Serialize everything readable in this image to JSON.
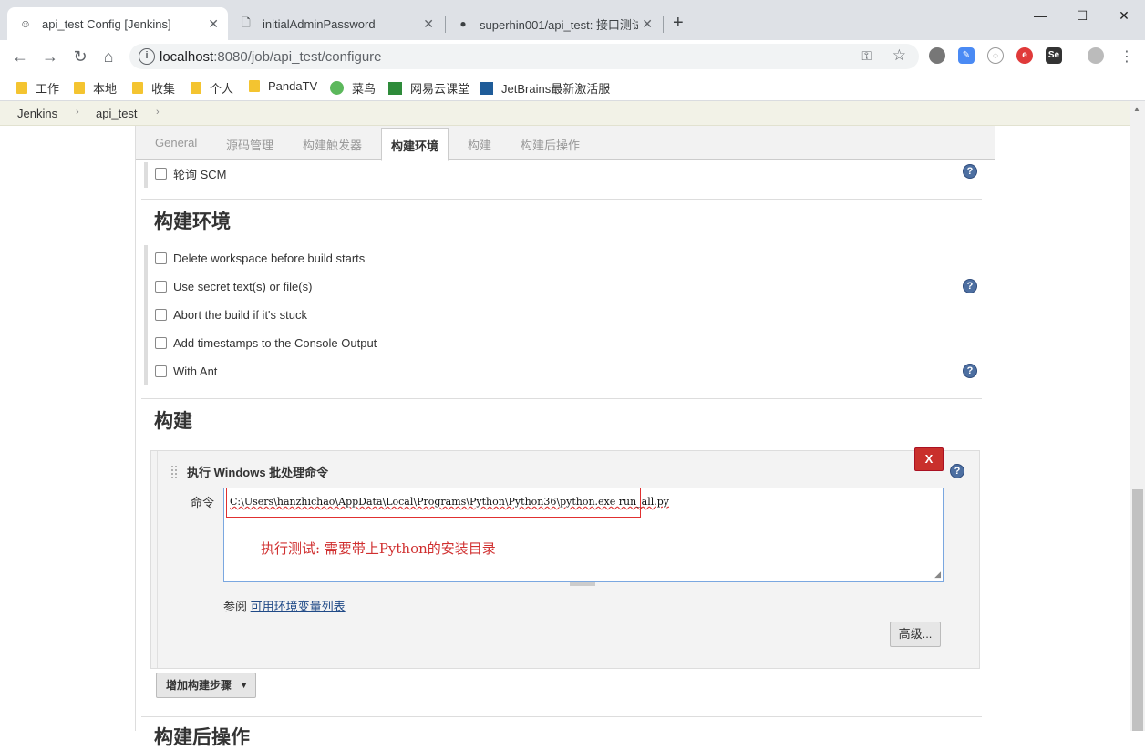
{
  "browser": {
    "tabs": [
      {
        "title": "api_test Config [Jenkins]",
        "icon": "jenkins-icon"
      },
      {
        "title": "initialAdminPassword",
        "icon": "document-icon"
      },
      {
        "title": "superhin001/api_test: 接口测试",
        "icon": "github-icon"
      }
    ],
    "url_host": "localhost",
    "url_rest": ":8080/job/api_test/configure",
    "bookmarks": [
      {
        "label": "工作",
        "icon": "folder-icon"
      },
      {
        "label": "本地",
        "icon": "folder-icon"
      },
      {
        "label": "收集",
        "icon": "folder-icon"
      },
      {
        "label": "个人",
        "icon": "folder-icon"
      },
      {
        "label": "PandaTV",
        "icon": "folder-icon"
      },
      {
        "label": "菜鸟",
        "icon": "runoob-icon"
      },
      {
        "label": "网易云课堂",
        "icon": "netease-icon"
      },
      {
        "label": "JetBrains最新激活服",
        "icon": "jetbrains-icon"
      }
    ]
  },
  "breadcrumbs": [
    "Jenkins",
    "api_test"
  ],
  "config_tabs": [
    "General",
    "源码管理",
    "构建触发器",
    "构建环境",
    "构建",
    "构建后操作"
  ],
  "poll_scm": "轮询 SCM",
  "build_env": {
    "title": "构建环境",
    "options": [
      "Delete workspace before build starts",
      "Use secret text(s) or file(s)",
      "Abort the build if it's stuck",
      "Add timestamps to the Console Output",
      "With Ant"
    ]
  },
  "build": {
    "title": "构建",
    "step_title": "执行 Windows 批处理命令",
    "delete_label": "X",
    "command_label": "命令",
    "command": "C:\\Users\\hanzhichao\\AppData\\Local\\Programs\\Python\\Python36\\python.exe run_all.py",
    "annotation": "执行测试: 需要带上Python的安装目录",
    "ref_prefix": "参阅",
    "ref_link": "可用环境变量列表",
    "advanced": "高级...",
    "add_step": "增加构建步骤"
  },
  "post_build_title": "构建后操作"
}
